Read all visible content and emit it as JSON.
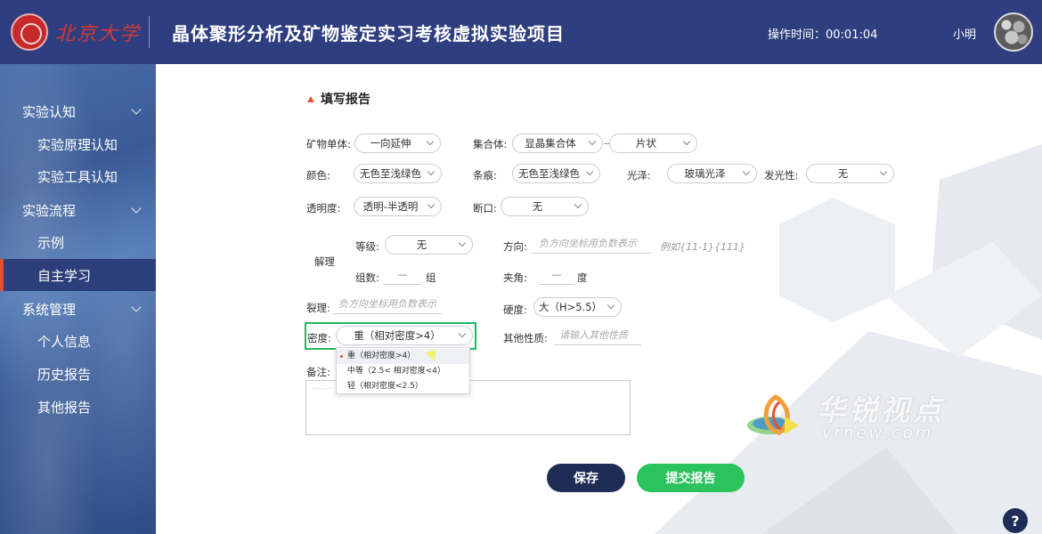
{
  "header": {
    "logo_text": "北京大学",
    "title": "晶体聚形分析及矿物鉴定实习考核虚拟实验项目",
    "op_time": "操作时间：00:01:04",
    "user": "小明"
  },
  "sidebar": {
    "groups": [
      {
        "label": "实验认知",
        "items": [
          "实验原理认知",
          "实验工具认知"
        ]
      },
      {
        "label": "实验流程",
        "items": [
          "示例",
          "自主学习"
        ]
      },
      {
        "label": "系统管理",
        "items": [
          "个人信息",
          "历史报告",
          "其他报告"
        ]
      }
    ],
    "active": "自主学习"
  },
  "form": {
    "section_title": "填写报告",
    "mineral_single": {
      "label": "矿物单体:",
      "value": "一向延伸"
    },
    "aggregate": {
      "label": "集合体:",
      "value1": "显晶集合体",
      "value2": "片状"
    },
    "color": {
      "label": "颜色:",
      "value": "无色至浅绿色"
    },
    "streak": {
      "label": "条痕:",
      "value": "无色至浅绿色"
    },
    "luster": {
      "label": "光泽:",
      "value": "玻璃光泽"
    },
    "luminescence": {
      "label": "发光性:",
      "value": "无"
    },
    "transparency": {
      "label": "透明度:",
      "value": "透明-半透明"
    },
    "fracture": {
      "label": "断口:",
      "value": "无"
    },
    "cleavage": {
      "label": "解理",
      "grade_label": "等级:",
      "grade_value": "无",
      "sets_label": "组数:",
      "sets_value": "—",
      "sets_unit": "组",
      "direction_label": "方向:",
      "direction_placeholder": "负方向坐标用负数表示",
      "direction_example": "例如{11-1}{111}",
      "angle_label": "夹角:",
      "angle_value": "—",
      "angle_unit": "度"
    },
    "parting": {
      "label": "裂理:",
      "placeholder": "负方向坐标用负数表示"
    },
    "hardness": {
      "label": "硬度:",
      "value": "大（H>5.5）"
    },
    "density": {
      "label": "密度:",
      "value": "重（相对密度>4）",
      "options": [
        "重（相对密度>4）",
        "中等（2.5< 相对密度<4）",
        "轻（相对密度<2.5）"
      ]
    },
    "other": {
      "label": "其他性质:",
      "placeholder": "请输入其他性质"
    },
    "notes": {
      "label": "备注:",
      "value": "......"
    },
    "save_label": "保存",
    "submit_label": "提交报告"
  },
  "watermark": {
    "cn": "华锐视点",
    "en": "vrnew.com"
  },
  "help_label": "?",
  "colors": {
    "header_bg": "#2f3e7e",
    "accent": "#e9552f",
    "primary_dark": "#1f2c55",
    "success": "#2bc35d",
    "highlight": "#1eb85e"
  }
}
